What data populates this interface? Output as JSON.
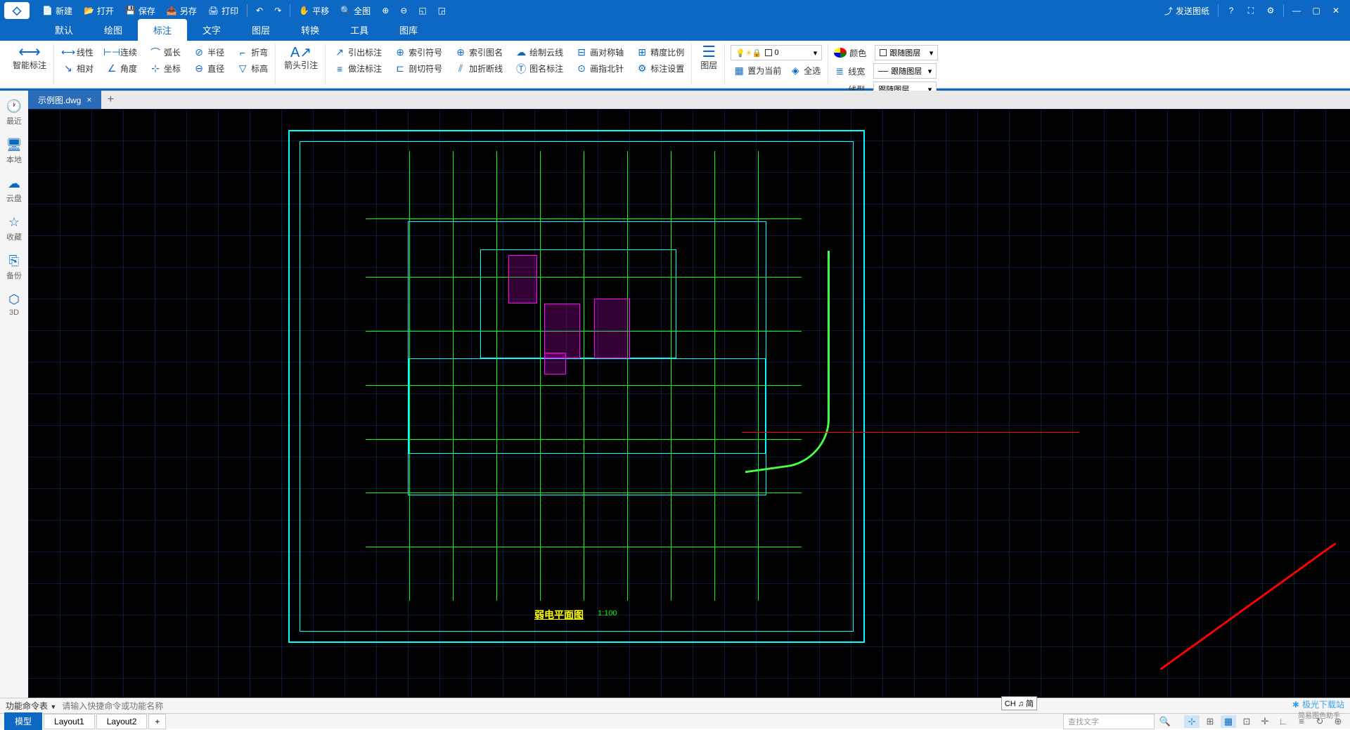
{
  "titlebar": {
    "new": "新建",
    "open": "打开",
    "save": "保存",
    "saveas": "另存",
    "print": "打印",
    "pan": "平移",
    "fit": "全图",
    "send": "发送图纸"
  },
  "menus": [
    "默认",
    "绘图",
    "标注",
    "文字",
    "图层",
    "转换",
    "工具",
    "图库"
  ],
  "active_menu": 2,
  "ribbon": {
    "smart": "智能标注",
    "g1": [
      "线性",
      "连续",
      "弧长",
      "半径",
      "折弯",
      "相对",
      "角度",
      "坐标",
      "直径",
      "标高"
    ],
    "arrow": "箭头引注",
    "g2": [
      "引出标注",
      "索引符号",
      "索引图名",
      "绘制云线",
      "画对称轴",
      "精度比例",
      "做法标注",
      "剖切符号",
      "加折断线",
      "图名标注",
      "画指北针",
      "标注设置"
    ],
    "layer": "图层",
    "set_current": "置为当前",
    "select_all": "全选",
    "layer_value": "0",
    "color": "颜色",
    "line_w": "线宽",
    "line_t": "线型",
    "follow_layer": "跟随图层"
  },
  "sidebar": [
    "最近",
    "本地",
    "云盘",
    "收藏",
    "备份",
    "3D"
  ],
  "doc_tab": "示例图.dwg",
  "drawing": {
    "title": "弱电平面图",
    "scale": "1:100"
  },
  "cmd": {
    "label": "功能命令表",
    "placeholder": "请输入快捷命令或功能名称"
  },
  "ime": "CH ♫ 简",
  "layouts": [
    "模型",
    "Layout1",
    "Layout2"
  ],
  "search_placeholder": "查找文字",
  "watermark": "极光下载站",
  "watermark_sub": "简易图色助手"
}
